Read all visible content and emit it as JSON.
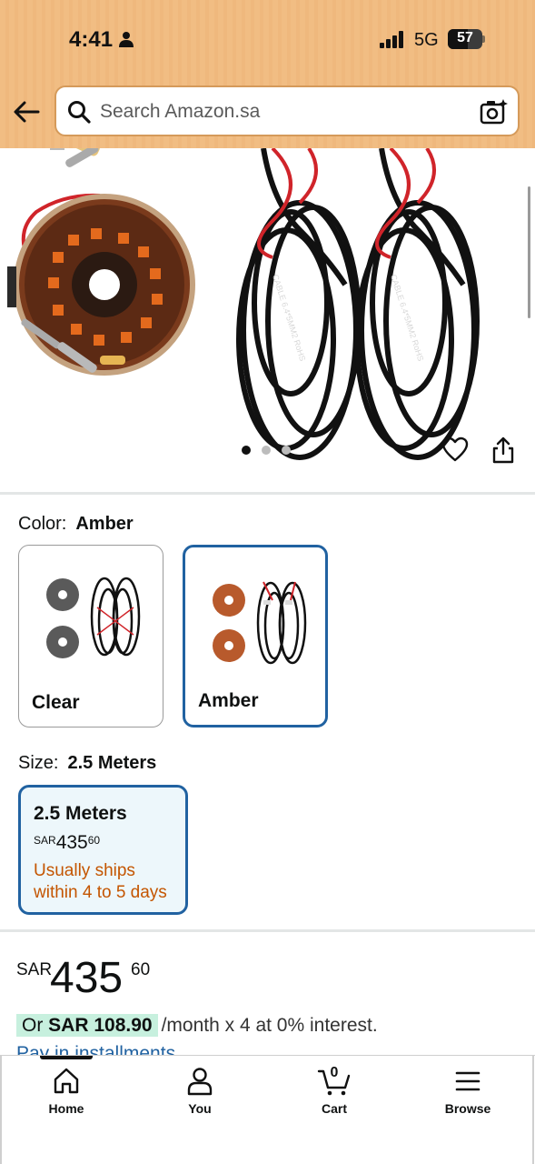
{
  "status_bar": {
    "time": "4:41",
    "network": "5G",
    "battery_level": "57"
  },
  "search": {
    "placeholder": "Search Amazon.sa"
  },
  "gallery": {
    "page_count": 3,
    "active_page": 1
  },
  "color": {
    "label": "Color:",
    "selected": "Amber",
    "options": [
      {
        "label": "Clear",
        "accent": "#6b6b6b"
      },
      {
        "label": "Amber",
        "accent": "#b85a2c"
      }
    ]
  },
  "size": {
    "label": "Size:",
    "selected": "2.5 Meters",
    "option": {
      "name": "2.5 Meters",
      "currency": "SAR",
      "whole": "435",
      "fraction": "60",
      "shipping": "Usually ships within 4 to 5 days"
    }
  },
  "price": {
    "currency": "SAR",
    "whole": "435",
    "fraction": "60",
    "installment_prefix": "Or",
    "installment_amount": "SAR 108.90",
    "installment_suffix": "/month x 4 at 0% interest.",
    "installment_link": "Pay in installments"
  },
  "tabbar": {
    "home": "Home",
    "you": "You",
    "cart": "Cart",
    "cart_count": "0",
    "browse": "Browse"
  },
  "colors": {
    "header_bg": "#f1bd83",
    "selected_border": "#2162a1",
    "shipping_text": "#c45500",
    "installment_highlight": "#c7f0de"
  }
}
